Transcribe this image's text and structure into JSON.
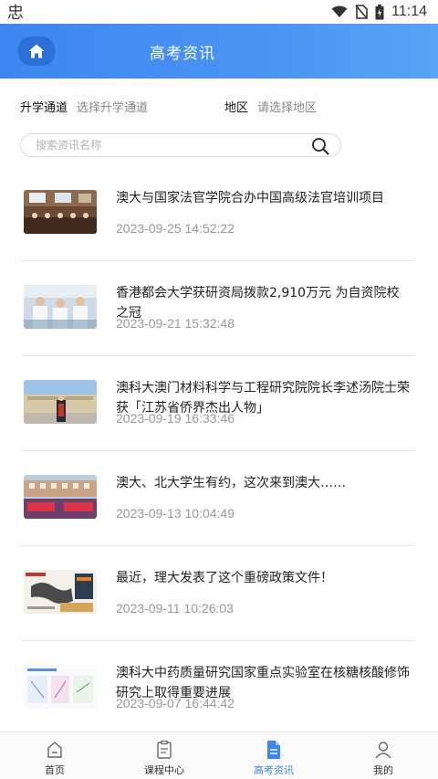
{
  "status_bar": {
    "app_glyph": "忠",
    "time": "11:14",
    "icons": [
      "wifi-icon",
      "no-sim-icon",
      "battery-icon"
    ]
  },
  "header": {
    "title": "高考资讯",
    "home_icon": "home-icon"
  },
  "filters": {
    "channel_label": "升学通道",
    "channel_value": "选择升学通道",
    "region_label": "地区",
    "region_value": "请选择地区"
  },
  "search": {
    "placeholder": "搜索资讯名称",
    "icon": "search-icon"
  },
  "news": [
    {
      "title": "澳大与国家法官学院合办中国高级法官培训项目",
      "date": "2023-09-25 14:52:22"
    },
    {
      "title": "香港都会大学获研资局拨款2,910万元 为自资院校之冠",
      "date": "2023-09-21 15:32:48"
    },
    {
      "title": "澳科大澳门材料科学与工程研究院院长李述汤院士荣获「江苏省侨界杰出人物」",
      "date": "2023-09-19 16:33:46"
    },
    {
      "title": "澳大、北大学生有约，这次来到澳大……",
      "date": "2023-09-13 10:04:49"
    },
    {
      "title": "最近，理大发表了这个重磅政策文件！",
      "date": "2023-09-11 10:26:03"
    },
    {
      "title": "澳科大中药质量研究国家重点实验室在核糖核酸修饰研究上取得重要进展",
      "date": "2023-09-07 16:44:42"
    }
  ],
  "bottom_nav": [
    {
      "label": "首页",
      "icon": "home-outline-icon",
      "active": false
    },
    {
      "label": "课程中心",
      "icon": "clipboard-icon",
      "active": false
    },
    {
      "label": "高考资讯",
      "icon": "document-icon",
      "active": true
    },
    {
      "label": "我的",
      "icon": "user-icon",
      "active": false
    }
  ],
  "colors": {
    "accent": "#3d86ef",
    "home_button": "#2e6fd6",
    "date_text": "#999999"
  }
}
